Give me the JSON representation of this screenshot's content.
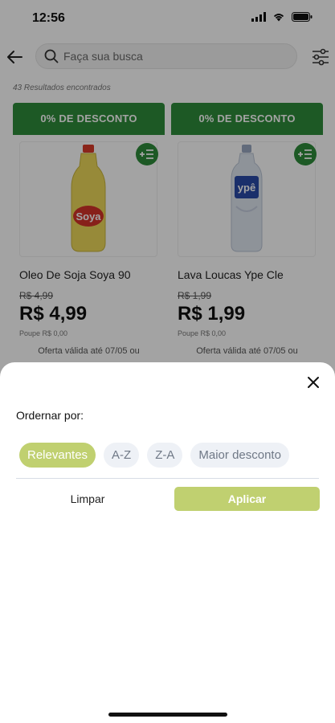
{
  "status": {
    "time": "12:56"
  },
  "search": {
    "placeholder": "Faça sua busca"
  },
  "results": {
    "count_text": "43 Resultados encontrados"
  },
  "products": [
    {
      "discount": "0% DE DESCONTO",
      "name": "Oleo De Soja Soya 90",
      "old_price": "R$ 4,99",
      "price": "R$ 4,99",
      "save": "Poupe R$ 0,00",
      "offer": "Oferta válida até 07/05 ou",
      "image_icon": "oil-bottle-image"
    },
    {
      "discount": "0% DE DESCONTO",
      "name": "Lava Loucas Ype  Cle",
      "old_price": "R$ 1,99",
      "price": "R$ 1,99",
      "save": "Poupe R$ 0,00",
      "offer": "Oferta válida até 07/05 ou",
      "image_icon": "detergent-bottle-image"
    }
  ],
  "sort_sheet": {
    "title": "Ordernar por:",
    "options": [
      "Relevantes",
      "A-Z",
      "Z-A",
      "Maior desconto"
    ],
    "selected": "Relevantes",
    "clear_label": "Limpar",
    "apply_label": "Aplicar"
  },
  "colors": {
    "brand_green": "#2e8b3a",
    "accent_lime": "#c0d070",
    "chip_bg": "#eef1f6"
  }
}
